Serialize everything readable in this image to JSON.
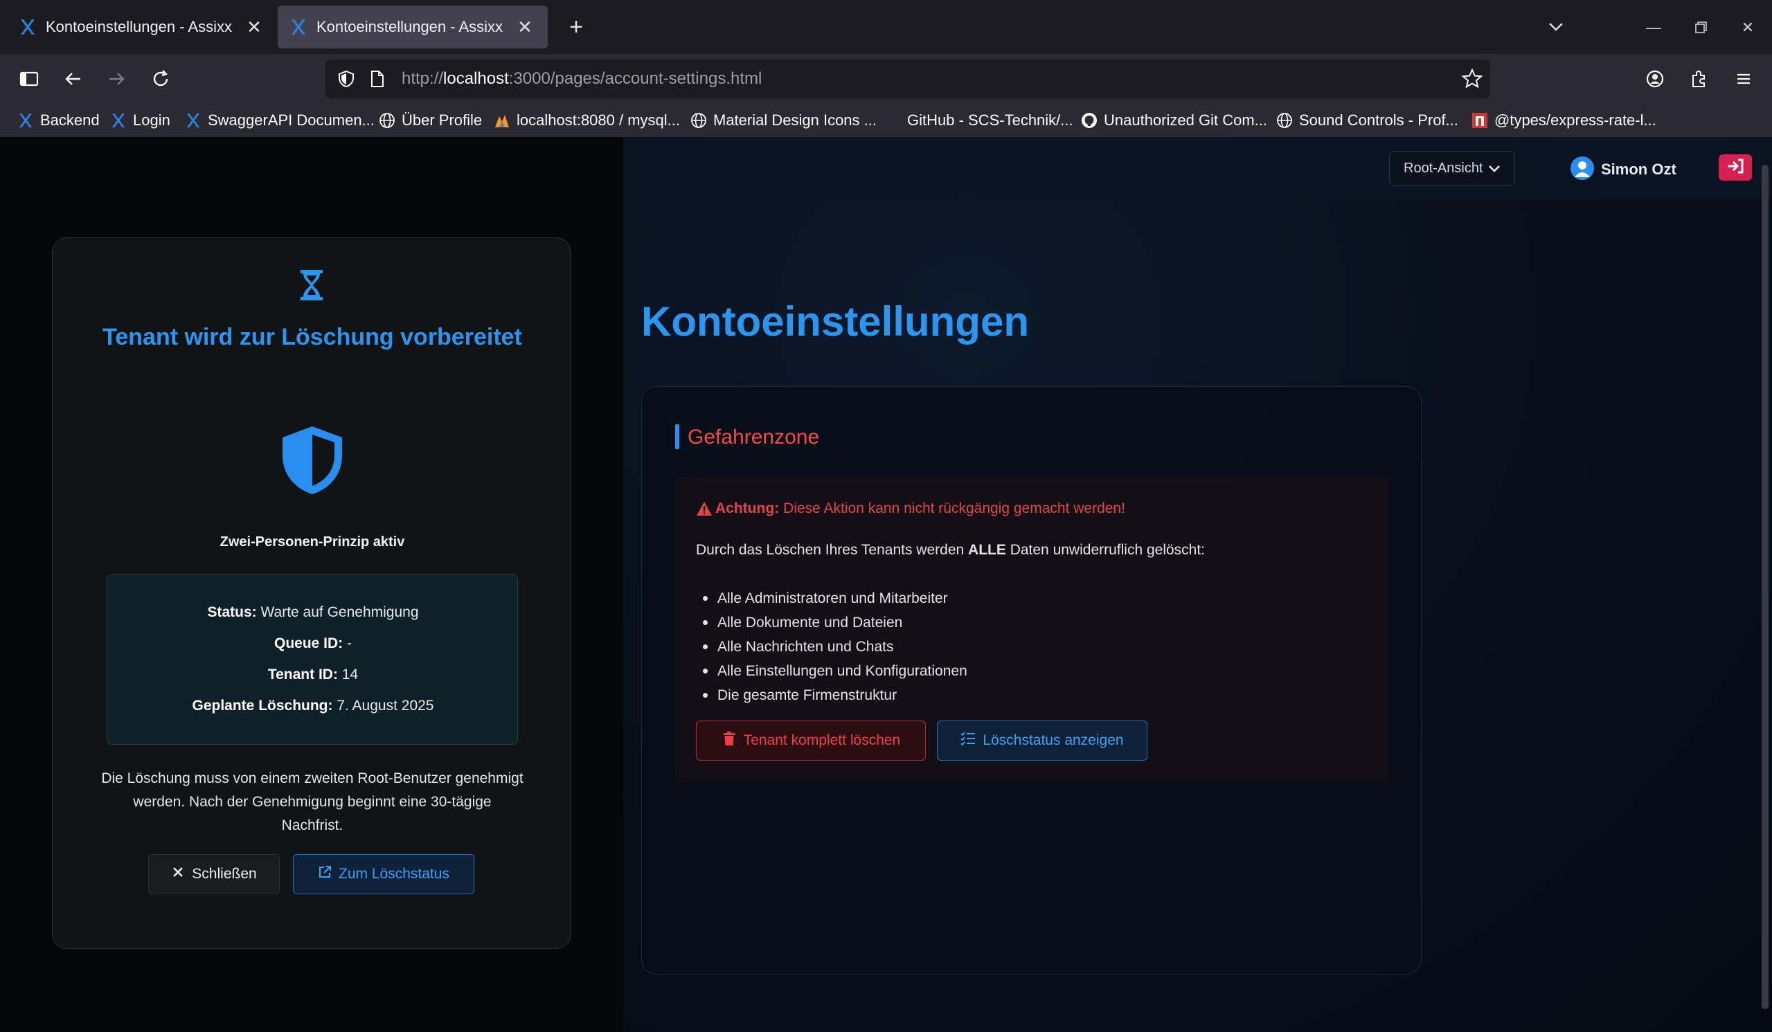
{
  "browser": {
    "tabs": [
      {
        "title": "Kontoeinstellungen - Assixx",
        "active": false
      },
      {
        "title": "Kontoeinstellungen - Assixx",
        "active": true
      }
    ],
    "url": {
      "scheme": "http://",
      "host": "localhost",
      "rest": ":3000/pages/account-settings.html"
    },
    "bookmarks": [
      {
        "label": "Backend",
        "icon": "assixx-icon"
      },
      {
        "label": "Login",
        "icon": "assixx-icon"
      },
      {
        "label": "SwaggerAPI Documen...",
        "icon": "assixx-icon"
      },
      {
        "label": "Über Profile",
        "icon": "globe-icon"
      },
      {
        "label": "localhost:8080 / mysql...",
        "icon": "phpmyadmin-icon"
      },
      {
        "label": "Material Design Icons ...",
        "icon": "globe-icon"
      },
      {
        "label": "GitHub - SCS-Technik/...",
        "icon": "github-icon"
      },
      {
        "label": "Unauthorized Git Com...",
        "icon": "github-icon"
      },
      {
        "label": "Sound Controls - Prof...",
        "icon": "globe-icon"
      },
      {
        "label": "@types/express-rate-l...",
        "icon": "npm-icon"
      }
    ]
  },
  "header": {
    "role_select": "Root-Ansicht",
    "user_name": "Simon Ozt"
  },
  "main": {
    "title": "Kontoeinstellungen",
    "danger": {
      "section_title": "Gefahrenzone",
      "warning_strong": "Achtung:",
      "warning_text": "Diese Aktion kann nicht rückgängig gemacht werden!",
      "intro_before": "Durch das Löschen Ihres Tenants werden",
      "intro_strong": "ALLE",
      "intro_after": "Daten unwiderruflich gelöscht:",
      "items": [
        "Alle Administratoren und Mitarbeiter",
        "Alle Dokumente und Dateien",
        "Alle Nachrichten und Chats",
        "Alle Einstellungen und Konfigurationen",
        "Die gesamte Firmenstruktur"
      ],
      "delete_button": "Tenant komplett löschen",
      "status_button": "Löschstatus anzeigen"
    }
  },
  "modal": {
    "title": "Tenant wird zur Löschung vorbereitet",
    "principle": "Zwei-Personen-Prinzip aktiv",
    "status_label": "Status:",
    "status_value": "Warte auf Genehmigung",
    "queue_label": "Queue ID:",
    "queue_value": "-",
    "tenant_label": "Tenant ID:",
    "tenant_value": "14",
    "planned_label": "Geplante Löschung:",
    "planned_value": "7. August 2025",
    "note": "Die Löschung muss von einem zweiten Root-Benutzer genehmigt werden. Nach der Genehmigung beginnt eine 30-tägige Nachfrist.",
    "close_button": "Schließen",
    "goto_button": "Zum Löschstatus"
  },
  "colors": {
    "accent": "#2a96f2",
    "danger": "#ef3f45",
    "logout": "#d6204f"
  }
}
